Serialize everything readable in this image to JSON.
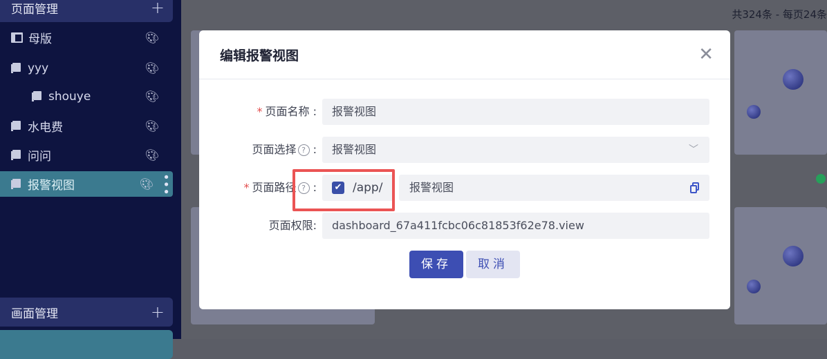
{
  "sidebar": {
    "section_top": "页面管理",
    "section_bottom": "画面管理",
    "add_symbol": "+",
    "items": [
      {
        "label": "母版"
      },
      {
        "label": "yyy"
      },
      {
        "label": "shouye"
      },
      {
        "label": "水电费"
      },
      {
        "label": "问问"
      },
      {
        "label": "报警视图"
      }
    ],
    "palette_icon": "palette-icon",
    "active_color": "#3b7a8f"
  },
  "main": {
    "count_text": "共324条 - 每页24条"
  },
  "modal": {
    "title": "编辑报警视图",
    "close_symbol": "✕",
    "fields": {
      "name_label": "页面名称",
      "name_value": "报警视图",
      "select_label": "页面选择",
      "select_value": "报警视图",
      "path_label": "页面路径",
      "path_prefix": "/app/",
      "path_value": "报警视图",
      "permission_label": "页面权限",
      "permission_value": "dashboard_67a411fcbc06c81853f62e78.view"
    },
    "colon": ":",
    "required_mark": "*",
    "help_symbol": "?",
    "save_label": "保存",
    "cancel_label": "取消",
    "accent_color": "#3d4eb3",
    "highlight_color": "#eb5454"
  }
}
